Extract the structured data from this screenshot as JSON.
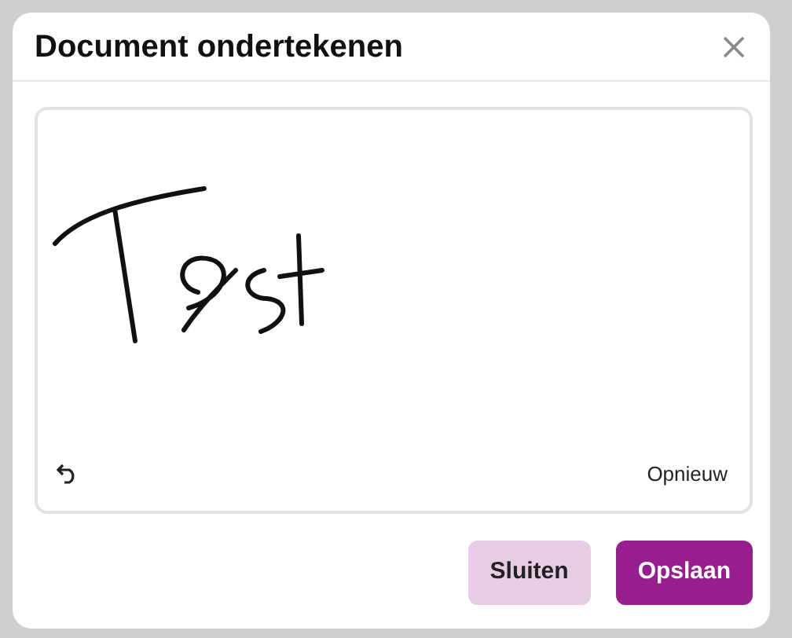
{
  "dialog": {
    "title": "Document ondertekenen",
    "signature_pad": {
      "has_signature": true,
      "reset_label": "Opnieuw"
    },
    "buttons": [
      {
        "label": "Sluiten",
        "kind": "secondary"
      },
      {
        "label": "Opslaan",
        "kind": "primary"
      }
    ]
  }
}
